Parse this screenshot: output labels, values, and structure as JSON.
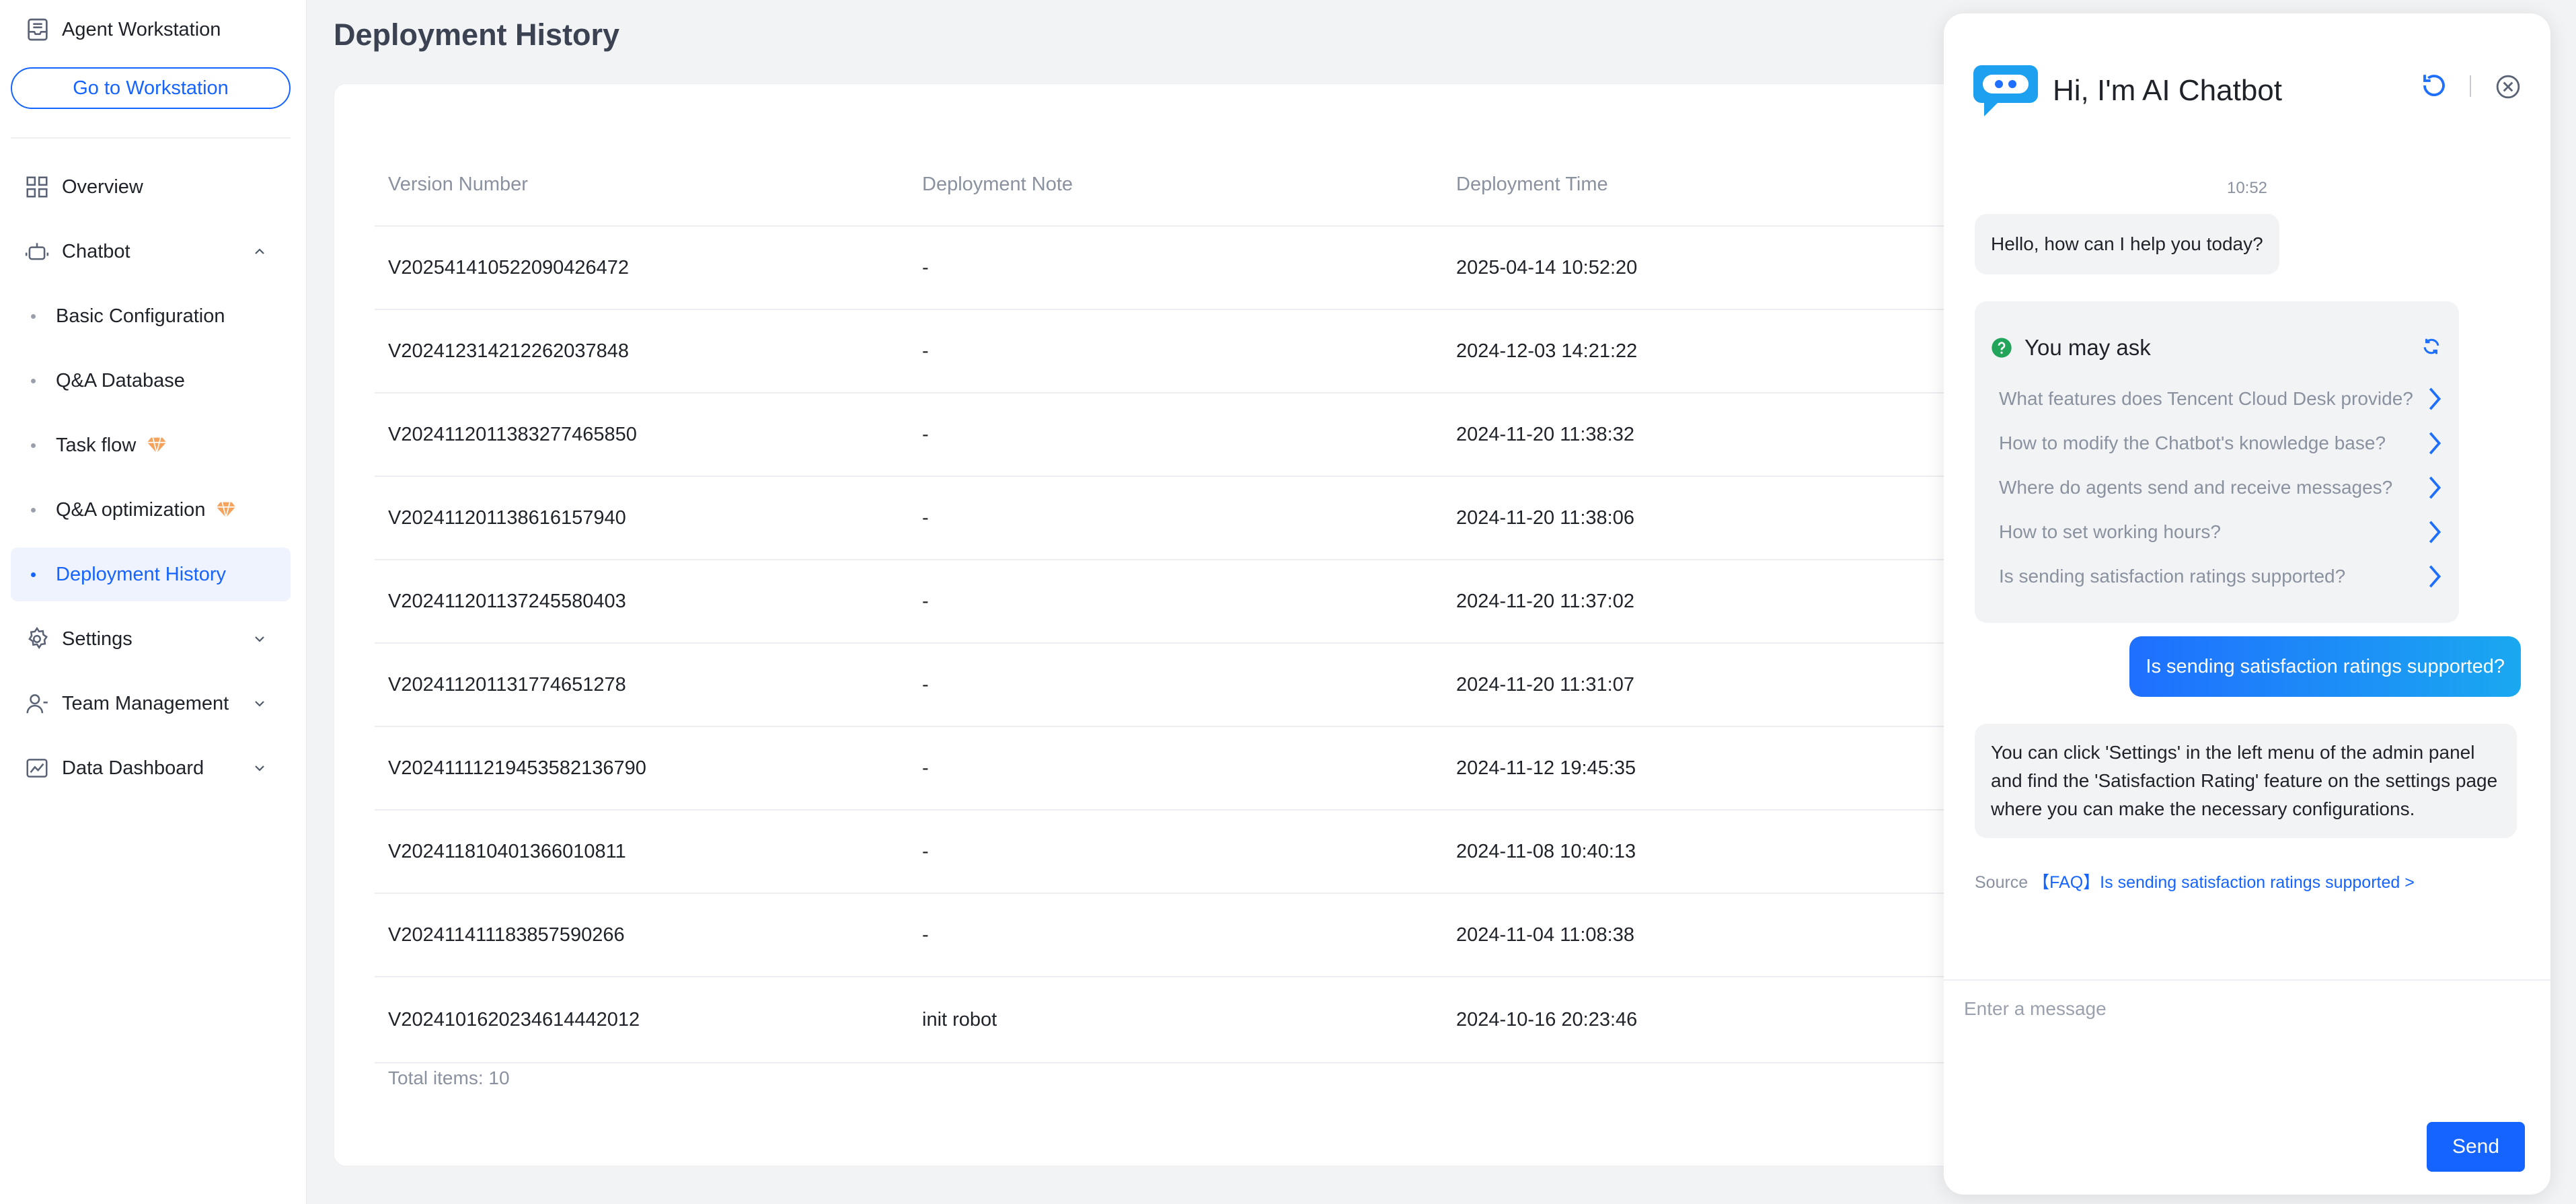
{
  "sidebar": {
    "workstation_label": "Agent Workstation",
    "goto_button": "Go to Workstation",
    "items": [
      {
        "label": "Overview"
      },
      {
        "label": "Chatbot"
      },
      {
        "label": "Basic Configuration"
      },
      {
        "label": "Q&A Database"
      },
      {
        "label": "Task flow"
      },
      {
        "label": "Q&A optimization"
      },
      {
        "label": "Deployment History"
      },
      {
        "label": "Settings"
      },
      {
        "label": "Team Management"
      },
      {
        "label": "Data Dashboard"
      }
    ],
    "active": "Deployment History"
  },
  "main": {
    "title": "Deployment History",
    "table": {
      "headers": [
        "Version Number",
        "Deployment Note",
        "Deployment Time"
      ],
      "rows": [
        [
          "V202541410522090426472",
          "-",
          "2025-04-14 10:52:20"
        ],
        [
          "V202412314212262037848",
          "-",
          "2024-12-03 14:21:22"
        ],
        [
          "V2024112011383277465850",
          "-",
          "2024-11-20 11:38:32"
        ],
        [
          "V202411201138616157940",
          "-",
          "2024-11-20 11:38:06"
        ],
        [
          "V202411201137245580403",
          "-",
          "2024-11-20 11:37:02"
        ],
        [
          "V202411201131774651278",
          "-",
          "2024-11-20 11:31:07"
        ],
        [
          "V20241111219453582136790",
          "-",
          "2024-11-12 19:45:35"
        ],
        [
          "V202411810401366010811",
          "-",
          "2024-11-08 10:40:13"
        ],
        [
          "V202411411183857590266",
          "-",
          "2024-11-04 11:08:38"
        ],
        [
          "V2024101620234614442012",
          "init robot",
          "2024-10-16 20:23:46"
        ]
      ]
    },
    "total_label": "Total items:",
    "total_count": "10"
  },
  "chat": {
    "title": "Hi, I'm AI Chatbot",
    "time": "10:52",
    "greeting": "Hello, how can I help you today?",
    "suggest_title": "You may ask",
    "suggestions": [
      "What features does Tencent Cloud Desk provide?",
      "How to modify the Chatbot's knowledge base?",
      "Where do agents send and receive messages?",
      "How to set working hours?",
      "Is sending satisfaction ratings supported?"
    ],
    "user_message": "Is sending satisfaction ratings supported?",
    "answer": "You can click 'Settings' in the left menu of the admin panel and find the 'Satisfaction Rating' feature on the settings page where you can make the necessary configurations.",
    "source_label": "Source",
    "source_link": "【FAQ】Is sending satisfaction ratings supported >",
    "input_placeholder": "Enter a message",
    "send_label": "Send"
  },
  "colors": {
    "accent": "#1664ff",
    "badge": "#f5a35c",
    "suggest_icon": "#22a55b"
  }
}
